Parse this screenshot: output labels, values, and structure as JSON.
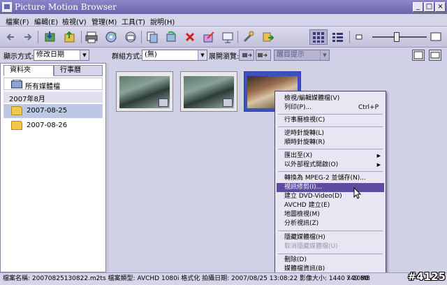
{
  "app": {
    "title": "Picture Motion Browser"
  },
  "window_controls": {
    "minimize": "_",
    "maximize": "□",
    "close": "×"
  },
  "menu": [
    "檔案(F)",
    "編輯(E)",
    "檢視(V)",
    "管理(M)",
    "工具(T)",
    "說明(H)"
  ],
  "toolbar": {
    "icons": [
      "back-icon",
      "forward-icon",
      "import-icon",
      "export-icon",
      "print-icon",
      "disc-burn-icon",
      "email-icon",
      "copy-icon",
      "rotate-icon",
      "delete-icon",
      "edit-icon",
      "slideshow-icon",
      "tools-icon",
      "share-icon",
      "thumbnail-view-icon",
      "list-view-icon",
      "zoom-out-icon",
      "zoom-in-icon"
    ],
    "zoom_level": 0.45
  },
  "filterbar": {
    "display_mode_label": "顯示方式:",
    "display_mode_value": "修改日期",
    "group_mode_label": "群組方式:",
    "group_mode_value": "(無)",
    "expand_label": "展開瀏覽:",
    "reminder_value": "醒目提示"
  },
  "leftpanel": {
    "tabs": [
      "資料夾",
      "行事曆"
    ],
    "all_media": "所有媒體檔",
    "month": "2007年8月",
    "folders": [
      "2007-08-25",
      "2007-08-26"
    ]
  },
  "context_menu": {
    "items": [
      {
        "label": "檢視/編輯媒體檔(V)",
        "shortcut": ""
      },
      {
        "label": "列印(P)...",
        "shortcut": "Ctrl+P"
      },
      {
        "label": "行事曆檢視(C)",
        "shortcut": ""
      },
      {
        "label": "逆時針旋轉(L)",
        "shortcut": ""
      },
      {
        "label": "順時針旋轉(R)",
        "shortcut": ""
      },
      {
        "label": "匯出至(X)",
        "shortcut": ""
      },
      {
        "label": "以外部程式開啟(O)",
        "shortcut": ""
      },
      {
        "label": "轉換為 MPEG-2 並儲存(N)...",
        "shortcut": ""
      },
      {
        "label": "視訊修剪(I)...",
        "shortcut": ""
      },
      {
        "label": "建立 DVD-Video(D)",
        "shortcut": ""
      },
      {
        "label": "AVCHD 建立(E)",
        "shortcut": ""
      },
      {
        "label": "地圖檢視(M)",
        "shortcut": ""
      },
      {
        "label": "分析視訊(Z)",
        "shortcut": ""
      },
      {
        "label": "隱藏媒體檔(H)",
        "shortcut": ""
      },
      {
        "label": "取消隱藏媒體檔(U)",
        "shortcut": ""
      },
      {
        "label": "刪除(D)",
        "shortcut": ""
      },
      {
        "label": "媒體檔資訊(B)",
        "shortcut": ""
      }
    ],
    "highlighted_index": 8,
    "disabled_index": 14,
    "submenu_indices": [
      5,
      6
    ]
  },
  "statusbar": {
    "text": "檔案名稱: 20070825130822.m2ts 檔案類型: AVCHD 1080i 格式化  拍攝日期: 2007/08/25 13:08:22  影像大小: 1440 x 1080",
    "size": "749 MB"
  },
  "watermark": "#4125",
  "colors": {
    "highlight": "#5e4ca0",
    "selection": "#3c50c0",
    "titlebar": "#7470ba"
  }
}
